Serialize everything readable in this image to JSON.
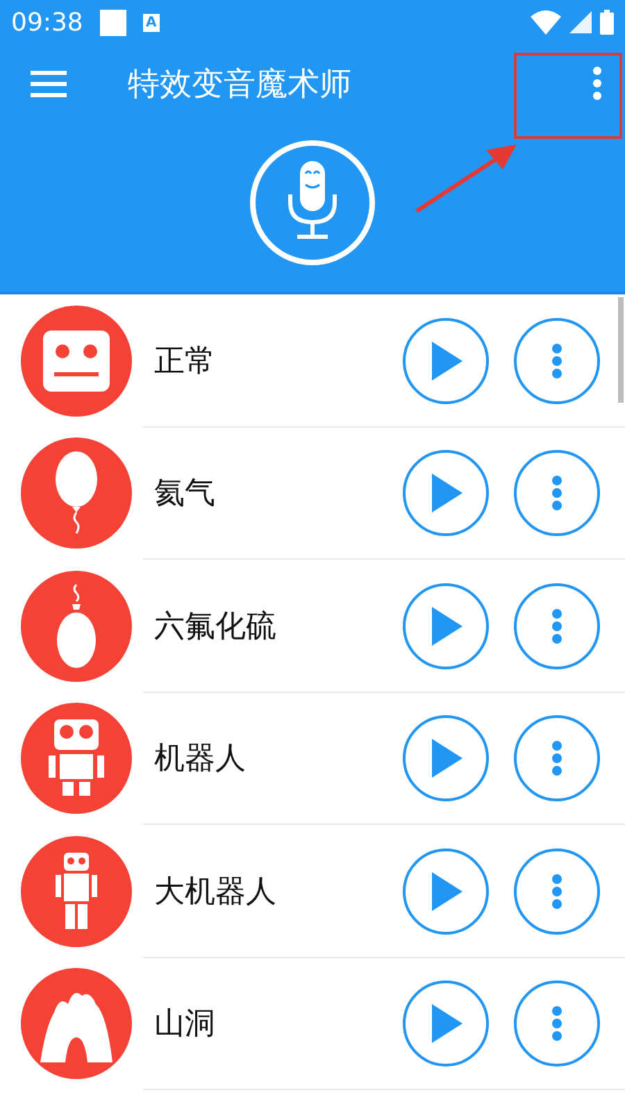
{
  "status_bar": {
    "time": "09:38",
    "notification_letter": "A"
  },
  "toolbar": {
    "title": "特效变音魔术师"
  },
  "effects": [
    {
      "name": "正常"
    },
    {
      "name": "氦气"
    },
    {
      "name": "六氟化硫"
    },
    {
      "name": "机器人"
    },
    {
      "name": "大机器人"
    },
    {
      "name": "山洞"
    }
  ]
}
